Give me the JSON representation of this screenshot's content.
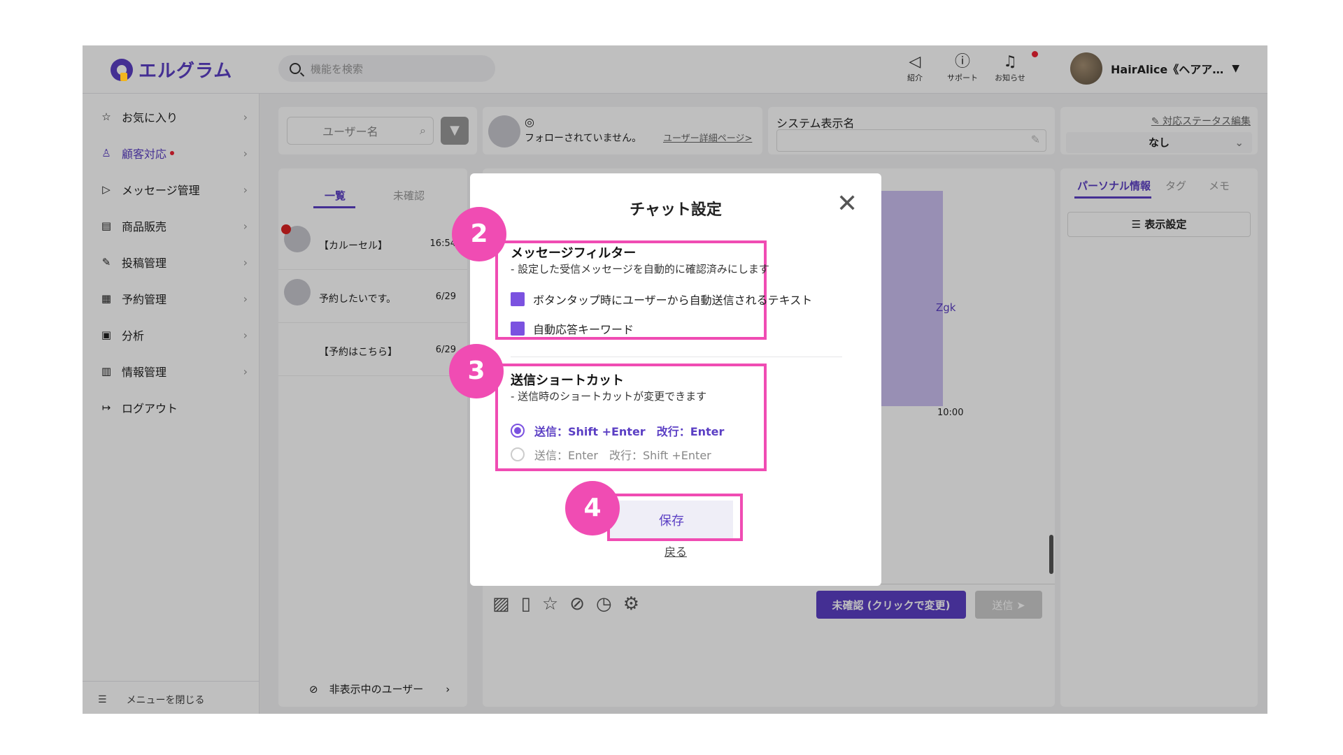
{
  "app": {
    "logo_text": "エルグラム",
    "search_placeholder": "機能を検索",
    "header_icons": [
      {
        "label": "紹介",
        "icon": "megaphone-icon"
      },
      {
        "label": "サポート",
        "icon": "question-icon"
      },
      {
        "label": "お知らせ",
        "icon": "bell-icon"
      }
    ],
    "user_name": "HairAlice《ヘアア…"
  },
  "sidebar": {
    "items": [
      {
        "label": "お気に入り",
        "icon": "star-icon"
      },
      {
        "label": "顧客対応",
        "icon": "person-icon",
        "active": true
      },
      {
        "label": "メッセージ管理",
        "icon": "send-icon"
      },
      {
        "label": "商品販売",
        "icon": "store-icon"
      },
      {
        "label": "投稿管理",
        "icon": "edit-icon"
      },
      {
        "label": "予約管理",
        "icon": "calendar-icon"
      },
      {
        "label": "分析",
        "icon": "report-icon"
      },
      {
        "label": "情報管理",
        "icon": "chart-icon"
      },
      {
        "label": "ログアウト",
        "icon": "logout-icon"
      }
    ],
    "close_label": "メニューを閉じる"
  },
  "list": {
    "username_placeholder": "ユーザー名",
    "tabs": [
      "一覧",
      "未確認"
    ],
    "conversations": [
      {
        "text": "【カルーセル】",
        "time": "16:54"
      },
      {
        "text": "予約したいです。",
        "time": "6/29"
      },
      {
        "text": "【予約はこちら】",
        "time": "6/29"
      }
    ],
    "hidden_users_label": "非表示中のユーザー"
  },
  "profile": {
    "not_following": "フォローされていません。",
    "detail_link": "ユーザー詳細ページ>"
  },
  "system_display": {
    "label": "システム表示名"
  },
  "status": {
    "edit_link": "対応ステータス編集",
    "value": "なし"
  },
  "chat": {
    "fragment_text": "Zgk",
    "fragment_time": "10:00",
    "unconfirmed_button": "未確認 (クリックで変更)",
    "send_button": "送信 ➤"
  },
  "right_panel": {
    "tabs": [
      "パーソナル情報",
      "タグ",
      "メモ"
    ],
    "display_settings": "☰ 表示設定"
  },
  "modal": {
    "title": "チャット設定",
    "close_glyph": "✕",
    "badges": [
      "2",
      "3",
      "4"
    ],
    "filter": {
      "heading": "メッセージフィルター",
      "description": "- 設定した受信メッセージを自動的に確認済みにします",
      "options": [
        "ボタンタップ時にユーザーから自動送信されるテキスト",
        "自動応答キーワード"
      ]
    },
    "shortcut": {
      "heading": "送信ショートカット",
      "description": "- 送信時のショートカットが変更できます",
      "options": [
        "送信：Shift +Enter　改行：Enter",
        "送信：Enter　改行：Shift +Enter"
      ],
      "selected_index": 0
    },
    "save_label": "保存",
    "back_label": "戻る"
  },
  "colors": {
    "brand": "#5b3fc4",
    "highlight": "#f04cb3",
    "checkbox": "#7b52e0"
  }
}
